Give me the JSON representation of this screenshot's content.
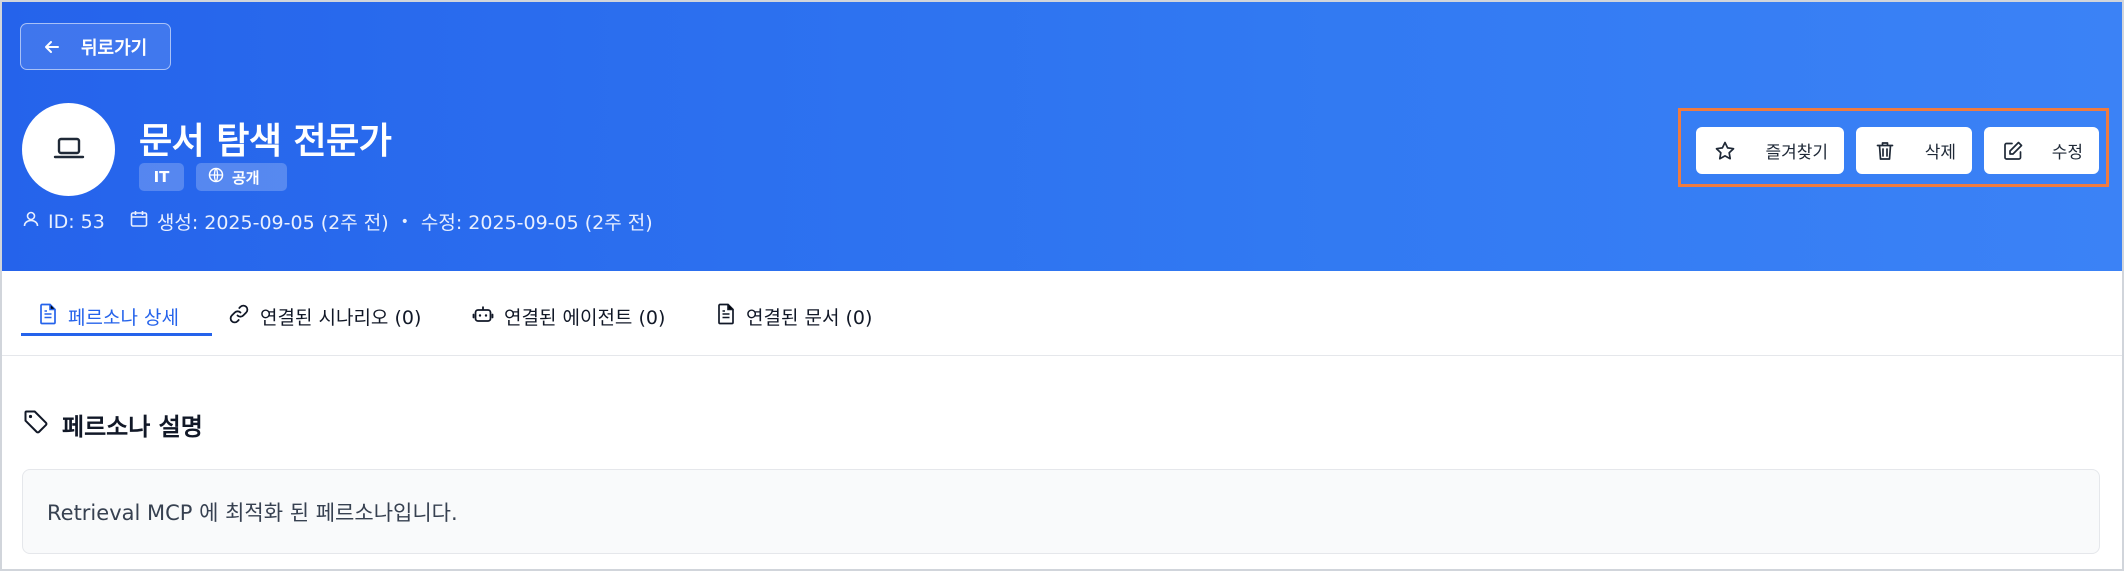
{
  "header": {
    "back_label": "뒤로가기",
    "title": "문서 탐색 전문가",
    "badges": {
      "category": "IT",
      "visibility": "공개"
    },
    "meta": {
      "id": "ID: 53",
      "created": "생성: 2025-09-05 (2주 전)",
      "updated": "수정: 2025-09-05 (2주 전)"
    },
    "actions": {
      "favorite": "즐겨찾기",
      "delete": "삭제",
      "edit": "수정"
    }
  },
  "tabs": [
    {
      "label": "페르소나 상세",
      "icon": "document-icon",
      "active": true
    },
    {
      "label": "연결된 시나리오 (0)",
      "icon": "link-icon",
      "active": false
    },
    {
      "label": "연결된 에이전트 (0)",
      "icon": "bot-icon",
      "active": false
    },
    {
      "label": "연결된 문서 (0)",
      "icon": "document-icon",
      "active": false
    }
  ],
  "section": {
    "title": "페르소나 설명",
    "description": "Retrieval MCP 에 최적화 된 페르소나입니다."
  },
  "colors": {
    "header_gradient_start": "#2563eb",
    "header_gradient_end": "#3b82f6",
    "accent": "#2563eb",
    "highlight_border": "#f07b3f"
  }
}
